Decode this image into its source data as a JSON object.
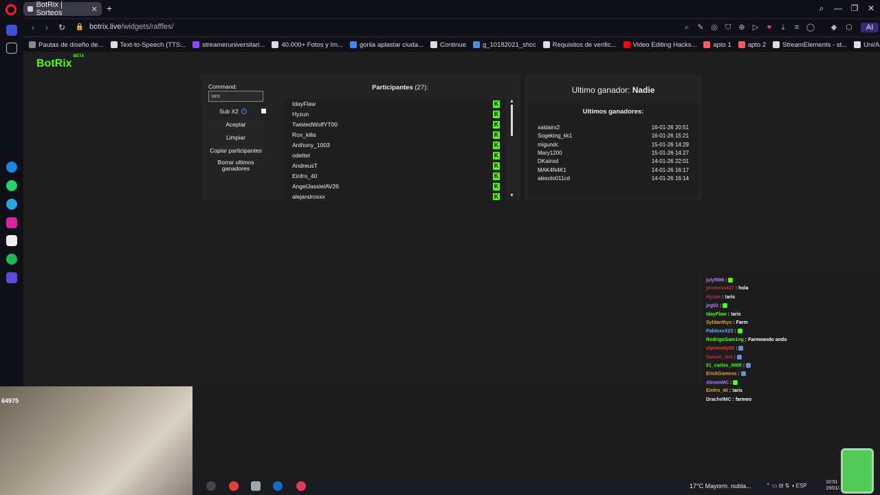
{
  "browser": {
    "tab_title": "BotRix | Sorteos",
    "url_host": "botrix.live",
    "url_path": "/widgets/raffles/",
    "ai_label": "AI",
    "bookmarks": [
      {
        "label": "Pautas de diseño de...",
        "color": "#888"
      },
      {
        "label": "Text-to-Speech (TTS...",
        "color": "#ddd"
      },
      {
        "label": "streameruniversitari...",
        "color": "#9146ff"
      },
      {
        "label": "40.000+ Fotos y Im...",
        "color": "#ddd"
      },
      {
        "label": "gorila aplastar ciuda...",
        "color": "#4285f4"
      },
      {
        "label": "Continue",
        "color": "#ddd"
      },
      {
        "label": "g_10182021_shcc",
        "color": "#4a90e2"
      },
      {
        "label": "Requisitos de verific...",
        "color": "#ddd"
      },
      {
        "label": "Video Editing Hacks...",
        "color": "#ff0000"
      },
      {
        "label": "apto 1",
        "color": "#ff5a5f"
      },
      {
        "label": "apto 2",
        "color": "#ff5a5f"
      },
      {
        "label": "StreamElements - st...",
        "color": "#ddd"
      },
      {
        "label": "Uni/Aris (@streame...",
        "color": "#ddd"
      }
    ]
  },
  "app": {
    "logo": "BotRix",
    "logo_badge": "BETA",
    "command_label": "Command:",
    "command_value": "!aris",
    "sub_x2_label": "Sub X2",
    "accept_label": "Aceptar",
    "clear_label": "Limpiar",
    "copy_label": "Copiar participantes",
    "delete_winners_label": "Borrar ultimos ganadores",
    "participants_title": "Participantes",
    "participants_count": "(27):",
    "participants": [
      "IdayFlaw",
      "Hyzun",
      "TwistedWolfYT00",
      "Rox_killa",
      "Anthony_1003",
      "odettet",
      "AndreusT",
      "Einfro_40",
      "AngelJassielAV26",
      "alejandrosxx"
    ],
    "last_winner_label": "Ultimo ganador:",
    "last_winner_value": "Nadie",
    "winners_title": "Ultimos ganadores:",
    "winners": [
      {
        "name": "xaldairx2",
        "date": "16-01-26 20:51"
      },
      {
        "name": "Sogeking_kk1",
        "date": "16-01-26 15:21"
      },
      {
        "name": "migundc",
        "date": "15-01-26 14:29"
      },
      {
        "name": "Mary1200",
        "date": "15-01-26 14:27"
      },
      {
        "name": "DKainxd",
        "date": "14-01-26 22:01"
      },
      {
        "name": "MAK4N4K1",
        "date": "14-01-26 16:17"
      },
      {
        "name": "alesoto011cd",
        "date": "14-01-26 16:14"
      }
    ]
  },
  "chat": [
    {
      "user": "julyf999",
      "msg": "",
      "color": "#b07cff",
      "emote": "green"
    },
    {
      "user": "promesa417",
      "msg": "hola",
      "color": "#c0304a",
      "emote": ""
    },
    {
      "user": "Hyzun",
      "msg": "!aris",
      "color": "#c0304a",
      "emote": ""
    },
    {
      "user": "jeg02",
      "msg": "",
      "color": "#b07cff",
      "emote": "green"
    },
    {
      "user": "IdayFlaw",
      "msg": "!aris",
      "color": "#53fc18",
      "emote": ""
    },
    {
      "user": "Syldanthys",
      "msg": "Farm",
      "color": "#e8a23c",
      "emote": ""
    },
    {
      "user": "PabloxeX23",
      "msg": "",
      "color": "#6ab0ff",
      "emote": "green"
    },
    {
      "user": "RodrigoGam1ng",
      "msg": "Farmeando ando",
      "color": "#53fc18",
      "emote": ""
    },
    {
      "user": "elprimoby02",
      "msg": "",
      "color": "#e04040",
      "emote": "blue"
    },
    {
      "user": "Sanuel_Gnl",
      "msg": "",
      "color": "#c0304a",
      "emote": "blue"
    },
    {
      "user": "01_carlos_0000",
      "msg": "",
      "color": "#53fc18",
      "emote": "blue"
    },
    {
      "user": "ErickGamess",
      "msg": "",
      "color": "#e8a23c",
      "emote": "blue"
    },
    {
      "user": "AbramMC",
      "msg": "",
      "color": "#b07cff",
      "emote": "green"
    },
    {
      "user": "Einfro_40",
      "msg": "!aris",
      "color": "#e8a23c",
      "emote": ""
    },
    {
      "user": "DrachelMC",
      "msg": "farmeo",
      "color": "#e8e8e8",
      "emote": ""
    }
  ],
  "overlay": {
    "viewer_count": "64975"
  },
  "taskbar": {
    "weather": "17°C  Mayorm. nubla...",
    "lang": "ESP",
    "time": "10:51",
    "date": "19/01/..."
  }
}
